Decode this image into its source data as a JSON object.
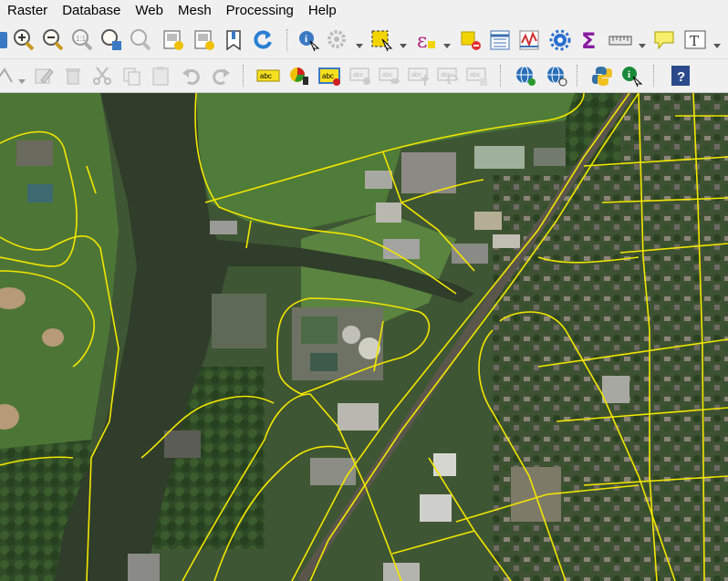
{
  "menu": [
    {
      "label": "Raster"
    },
    {
      "label": "Database"
    },
    {
      "label": "Web"
    },
    {
      "label": "Mesh"
    },
    {
      "label": "Processing"
    },
    {
      "label": "Help"
    }
  ],
  "toolbar_text_button": "T",
  "colors": {
    "road": "#f3e600",
    "river": "#2f3d2a",
    "grass": "#4d7a36",
    "toolbar_bg": "#f0f0f0"
  }
}
